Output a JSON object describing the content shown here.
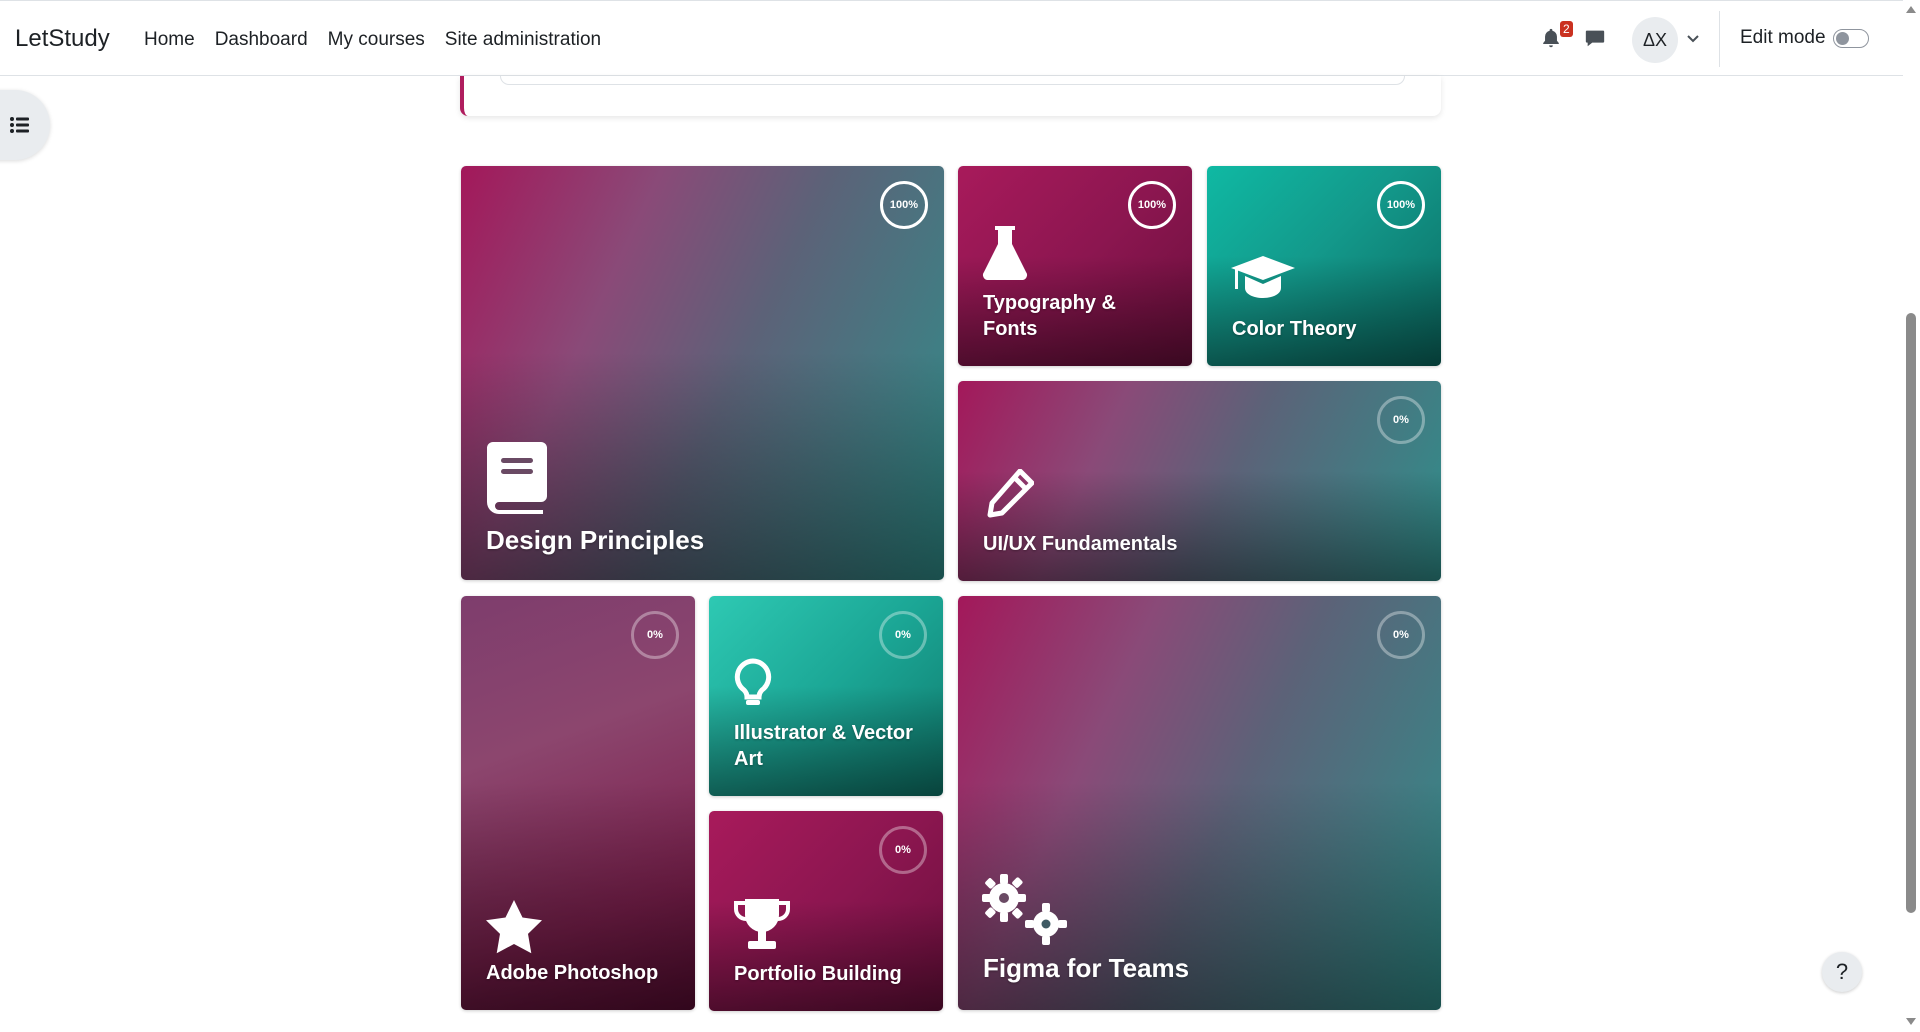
{
  "navbar": {
    "brand": "LetStudy",
    "links": [
      "Home",
      "Dashboard",
      "My courses",
      "Site administration"
    ],
    "notification_count": "2",
    "avatar_initials": "ΔX",
    "edit_mode_label": "Edit mode",
    "edit_mode_on": false
  },
  "help": {
    "label": "?"
  },
  "courses": [
    {
      "title": "Design Principles",
      "progress": "100%",
      "icon": "book-icon"
    },
    {
      "title": "Typography & Fonts",
      "progress": "100%",
      "icon": "flask-icon"
    },
    {
      "title": "Color Theory",
      "progress": "100%",
      "icon": "graduation-cap-icon"
    },
    {
      "title": "UI/UX Fundamentals",
      "progress": "0%",
      "icon": "pencil-icon"
    },
    {
      "title": "Adobe Photoshop",
      "progress": "0%",
      "icon": "star-icon"
    },
    {
      "title": "Illustrator & Vector Art",
      "progress": "0%",
      "icon": "lightbulb-icon"
    },
    {
      "title": "Portfolio Building",
      "progress": "0%",
      "icon": "trophy-icon"
    },
    {
      "title": "Figma for Teams",
      "progress": "0%",
      "icon": "gears-icon"
    }
  ],
  "colors": {
    "magenta": "#a81a5b",
    "teal": "#13998b",
    "text": "#1d2125"
  }
}
